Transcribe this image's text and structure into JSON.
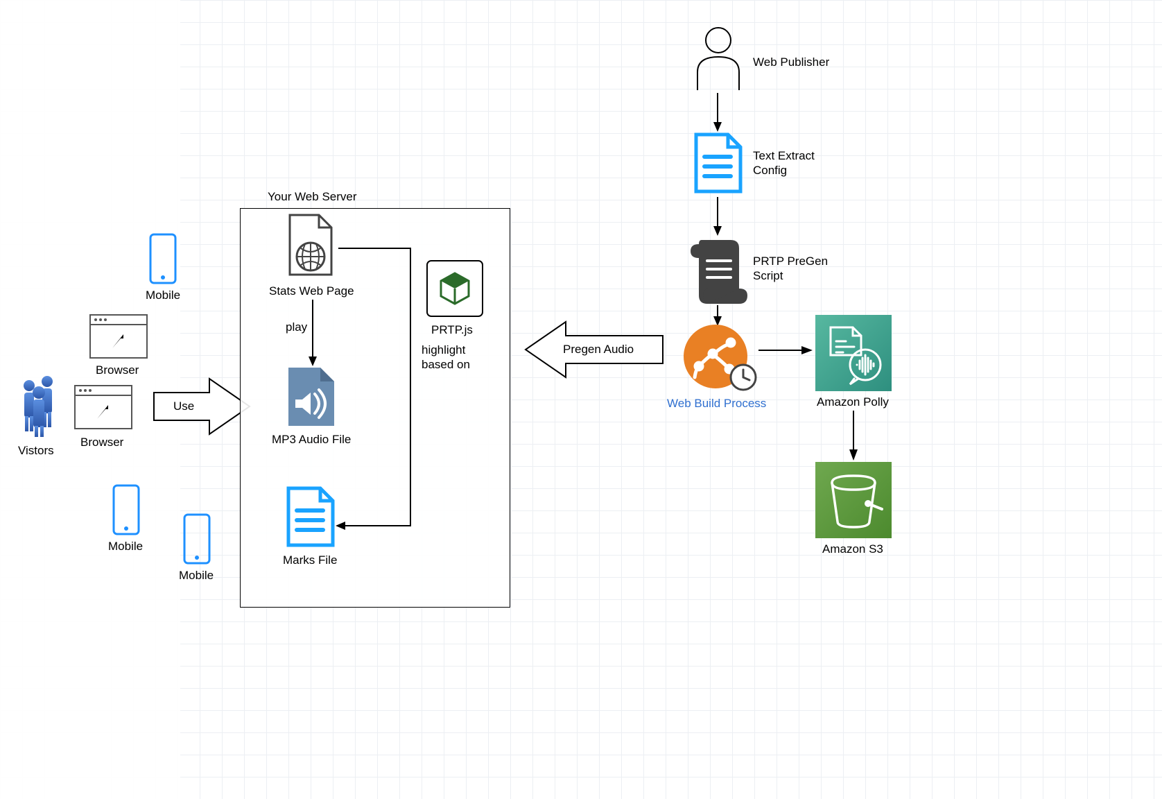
{
  "diagram": {
    "visitors_label": "Vistors",
    "mobile_label": "Mobile",
    "browser_label": "Browser",
    "use_label": "Use",
    "server_title": "Your Web Server",
    "stats_page_label": "Stats Web Page",
    "prtp_js_label": "PRTP.js",
    "play_label": "play",
    "highlight_line1": "highlight",
    "highlight_line2": "based on",
    "mp3_label": "MP3 Audio File",
    "marks_label": "Marks File",
    "pregen_label": "Pregen Audio",
    "web_publisher_label": "Web Publisher",
    "text_extract_line1": "Text Extract",
    "text_extract_line2": "Config",
    "pregen_script_line1": "PRTP PreGen",
    "pregen_script_line2": "Script",
    "web_build_label": "Web Build Process",
    "polly_label": "Amazon Polly",
    "s3_label": "Amazon S3"
  },
  "colors": {
    "blue": "#19A3FF",
    "darkgrey": "#434343",
    "polly_a": "#2E8F7F",
    "polly_b": "#57B8A0",
    "s3_a": "#4C8A2E",
    "s3_b": "#6FA84F",
    "orange": "#E98024",
    "audio_blue": "#6A8DB1",
    "box_green": "#2B6B2A"
  }
}
